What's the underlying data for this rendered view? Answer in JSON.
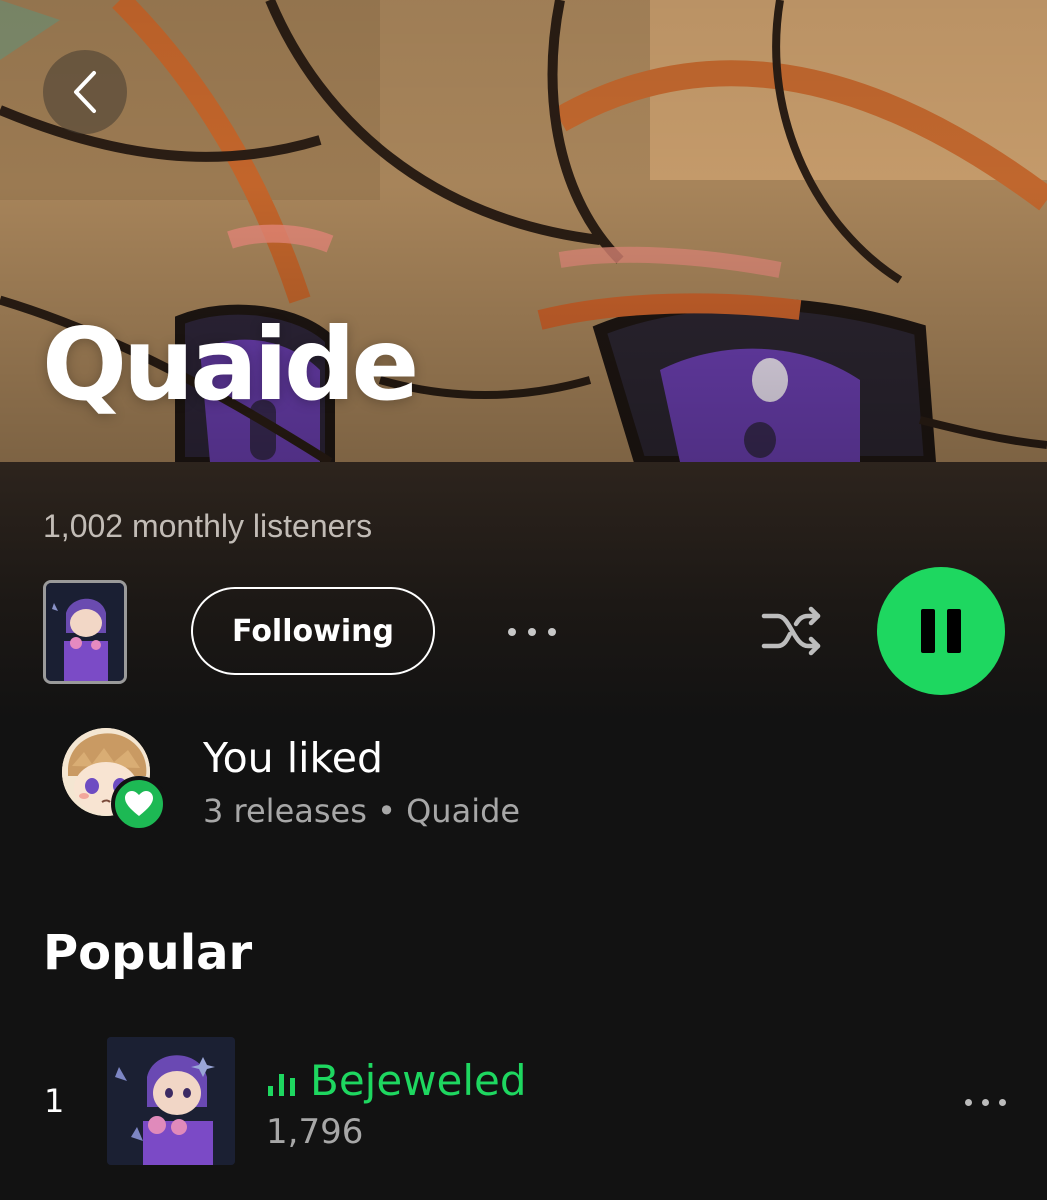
{
  "header": {
    "artist_name": "Quaide",
    "back_icon": "chevron-left-icon"
  },
  "stats": {
    "monthly_listeners": "1,002 monthly listeners"
  },
  "actions": {
    "following_label": "Following",
    "more_icon": "more-horizontal-icon",
    "shuffle_icon": "shuffle-icon",
    "play_state_icon": "pause-icon"
  },
  "liked": {
    "title": "You liked",
    "subtitle": "3 releases • Quaide",
    "badge_icon": "heart-icon"
  },
  "popular": {
    "title": "Popular",
    "tracks": [
      {
        "rank": "1",
        "title": "Bejeweled",
        "plays": "1,796",
        "now_playing": true
      }
    ]
  },
  "colors": {
    "accent_green": "#1ed760",
    "background": "#121212",
    "secondary_text": "#a7a7a7"
  }
}
